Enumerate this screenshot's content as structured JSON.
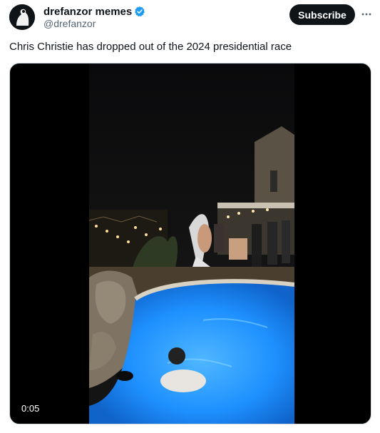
{
  "author": {
    "display_name": "drefanzor memes",
    "handle": "@drefanzor",
    "verified": true,
    "avatar_icon": "avatar-image"
  },
  "actions": {
    "subscribe_label": "Subscribe",
    "more_icon": "more-options-icon"
  },
  "tweet": {
    "text": "Chris Christie has dropped out of the 2024 presidential race"
  },
  "media": {
    "type": "video",
    "duration": "0:05"
  },
  "colors": {
    "verified_badge": "#1d9bf0",
    "subscribe_bg": "#0f1419",
    "handle_text": "#536471",
    "pool_water": "#1e90ff"
  }
}
